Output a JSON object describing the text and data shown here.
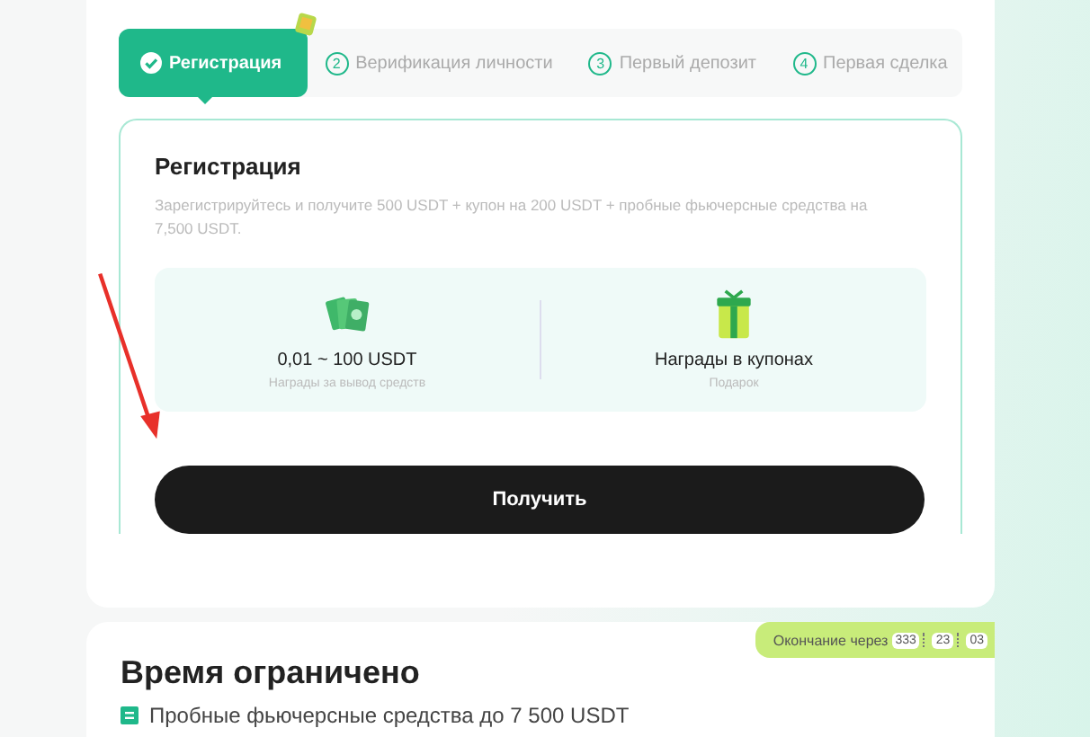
{
  "steps": [
    {
      "label": "Регистрация",
      "selected": true
    },
    {
      "number": "2",
      "label": "Верификация личности",
      "selected": false
    },
    {
      "number": "3",
      "label": "Первый депозит",
      "selected": false
    },
    {
      "number": "4",
      "label": "Первая сделка",
      "selected": false
    }
  ],
  "task": {
    "title": "Регистрация",
    "description": "Зарегистрируйтесь и получите 500 USDT + купон на 200 USDT + пробные фьючерсные средства на 7,500 USDT.",
    "rewards": [
      {
        "kind": "cards",
        "value": "0,01 ~ 100 USDT",
        "caption": "Награды за вывод средств"
      },
      {
        "kind": "gift",
        "value": "Награды в купонах",
        "caption": "Подарок"
      }
    ],
    "button": "Получить"
  },
  "promo": {
    "countdown_label": "Окончание через",
    "countdown": [
      "333",
      "23",
      "03"
    ],
    "title": "Время ограничено",
    "item": "Пробные фьючерсные средства до 7 500 USDT"
  }
}
